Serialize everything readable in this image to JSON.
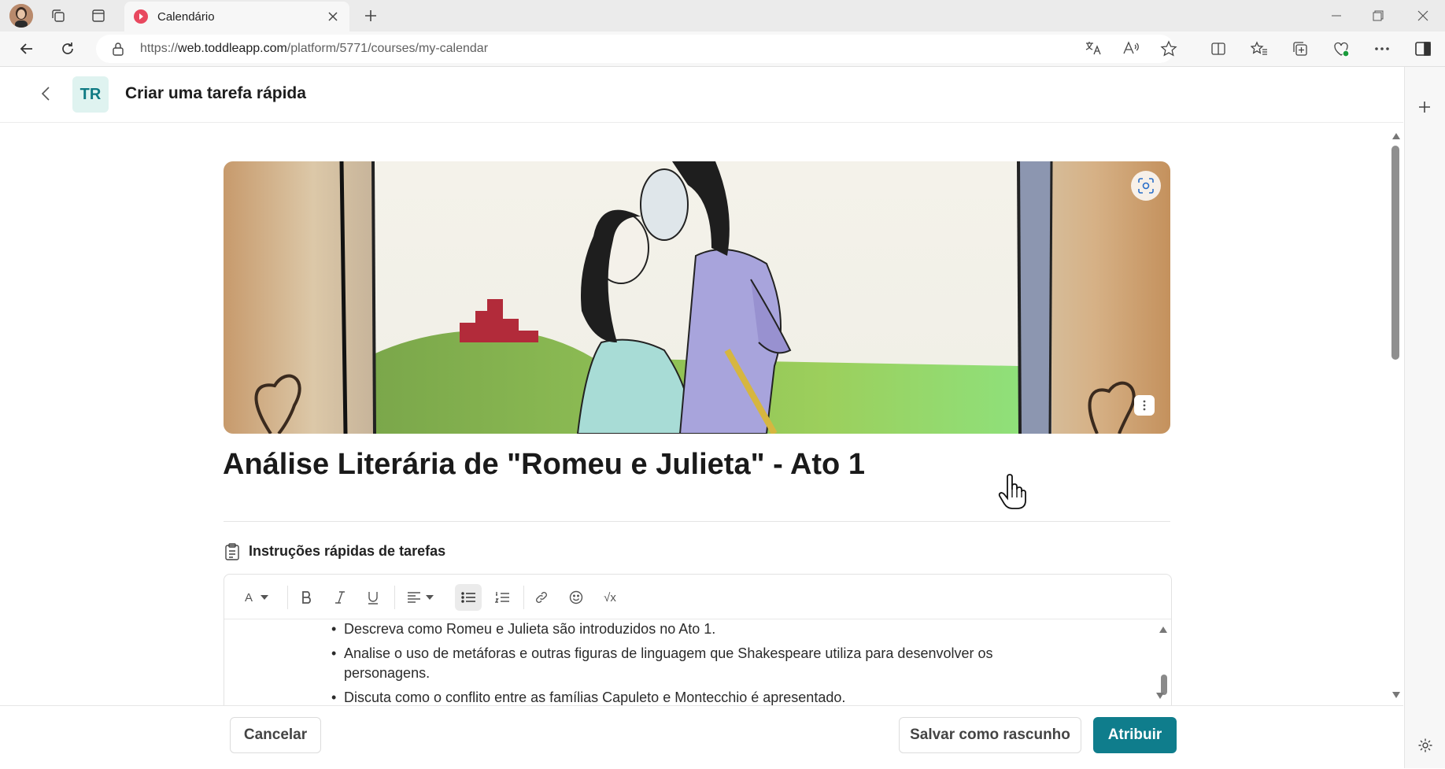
{
  "browser": {
    "tab_title": "Calendário",
    "url_prefix": "https://",
    "url_host": "web.toddleapp.com",
    "url_path": "/platform/5771/courses/my-calendar"
  },
  "header": {
    "badge": "TR",
    "title": "Criar uma tarefa rápida"
  },
  "task": {
    "title": "Análise Literária de \"Romeu e Julieta\" - Ato 1",
    "instructions_label": "Instruções rápidas de tarefas",
    "instructions": [
      "Descreva como Romeu e Julieta são introduzidos no Ato 1.",
      "Analise o uso de metáforas e outras figuras de linguagem que Shakespeare utiliza para desenvolver os personagens.",
      "Discuta como o conflito entre as famílias Capuleto e Montecchio é apresentado."
    ]
  },
  "toolbar": {
    "font_label": "A",
    "formula_label": "√x"
  },
  "footer": {
    "cancel_label": "Cancelar",
    "draft_label": "Salvar como rascunho",
    "assign_label": "Atribuir"
  },
  "colors": {
    "accent": "#0f7d8c",
    "badge_bg": "#dff3f0",
    "badge_text": "#0f7a83",
    "tab_favicon": "#e8485f"
  }
}
